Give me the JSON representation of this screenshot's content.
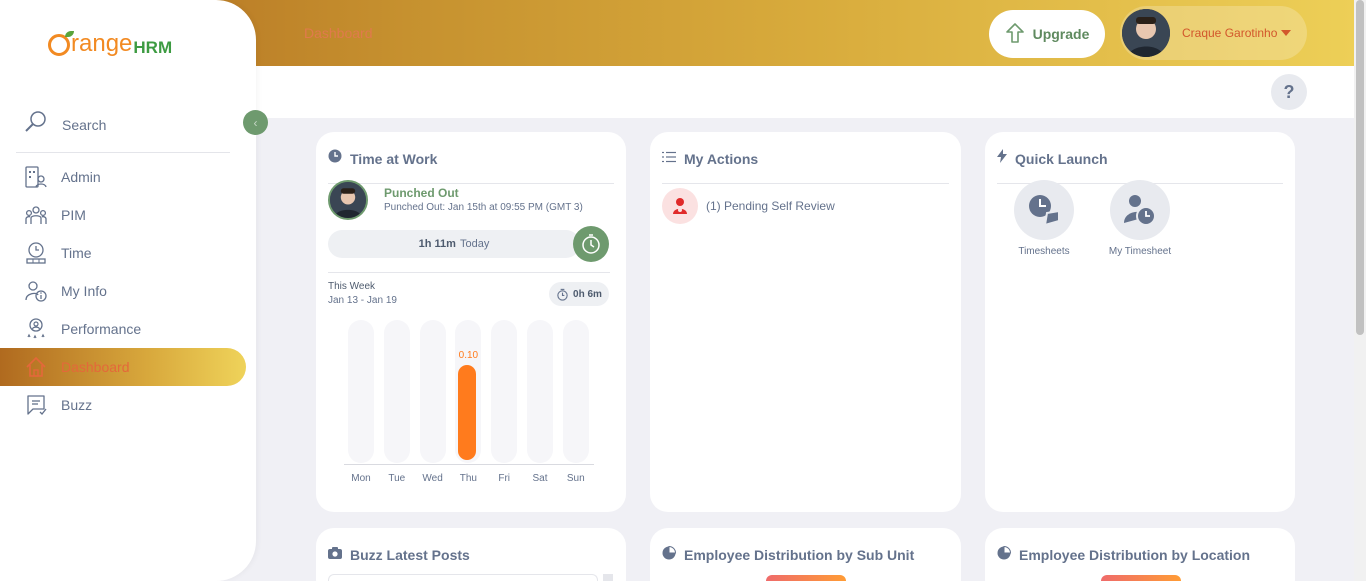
{
  "app": {
    "brand_range": "range",
    "brand_hrm": "HRM",
    "page_title": "Dashboard"
  },
  "header": {
    "upgrade_label": "Upgrade",
    "user_name": "Craque Garotinho",
    "help_label": "?"
  },
  "sidebar": {
    "search_label": "Search",
    "items": [
      {
        "label": "Admin",
        "icon": "admin-icon"
      },
      {
        "label": "PIM",
        "icon": "pim-icon"
      },
      {
        "label": "Time",
        "icon": "time-icon"
      },
      {
        "label": "My Info",
        "icon": "my-info-icon"
      },
      {
        "label": "Performance",
        "icon": "performance-icon"
      },
      {
        "label": "Dashboard",
        "icon": "dashboard-icon",
        "active": true
      },
      {
        "label": "Buzz",
        "icon": "buzz-icon"
      }
    ]
  },
  "time_at_work": {
    "title": "Time at Work",
    "status": "Punched Out",
    "status_detail": "Punched Out: Jan 15th at 09:55 PM (GMT 3)",
    "today_value": "1h 11m",
    "today_label": "Today",
    "week_label": "This Week",
    "week_range": "Jan 13 - Jan 19",
    "week_total": "0h 6m",
    "days": [
      "Mon",
      "Tue",
      "Wed",
      "Thu",
      "Fri",
      "Sat",
      "Sun"
    ],
    "values": [
      0,
      0,
      0,
      0.1,
      0,
      0,
      0
    ],
    "value_labels": [
      "",
      "",
      "",
      "0.10",
      "",
      "",
      ""
    ],
    "accent_color": "#ff7b1d"
  },
  "my_actions": {
    "title": "My Actions",
    "items": [
      {
        "text": "(1) Pending Self Review",
        "icon": "person-review-icon"
      }
    ]
  },
  "quick_launch": {
    "title": "Quick Launch",
    "items": [
      {
        "label": "Timesheets",
        "icon": "timesheets-icon"
      },
      {
        "label": "My Timesheet",
        "icon": "my-timesheet-icon"
      }
    ]
  },
  "bottom_cards": {
    "buzz_title": "Buzz Latest Posts",
    "sub_unit_title": "Employee Distribution by Sub Unit",
    "location_title": "Employee Distribution by Location"
  },
  "colors": {
    "primary_green": "#6e9a6e",
    "accent_orange": "#ff7b1d",
    "header_gradient_start": "#b06a1f",
    "header_gradient_end": "#edcf57"
  }
}
